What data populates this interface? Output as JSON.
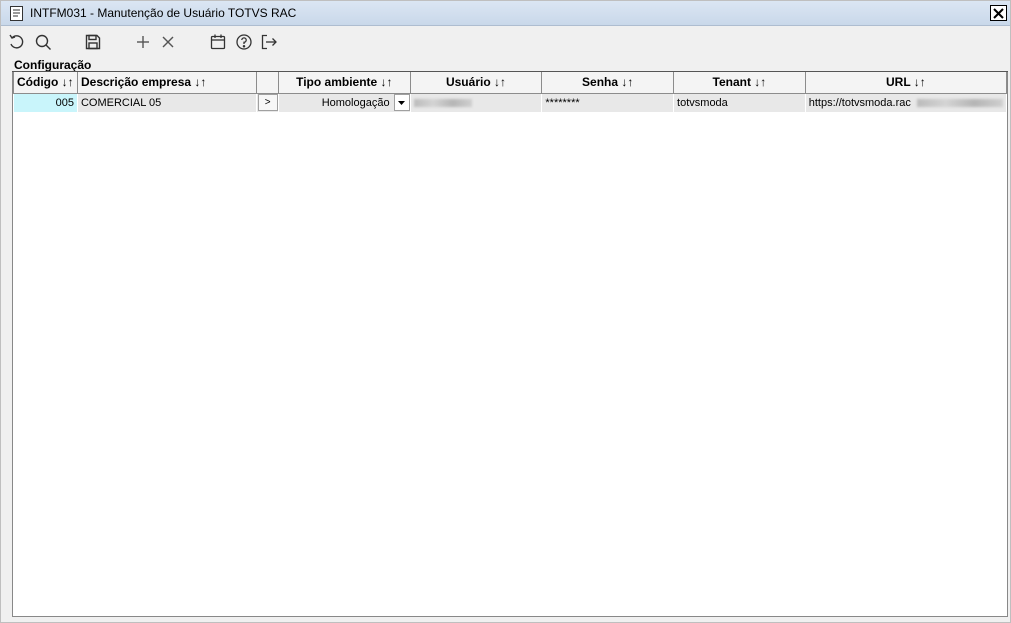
{
  "window": {
    "title": "INTFM031 - Manutenção de Usuário TOTVS RAC"
  },
  "toolbar": {
    "icons": [
      "refresh-icon",
      "search-icon",
      "save-icon",
      "add-icon",
      "delete-icon",
      "calendar-icon",
      "help-icon",
      "exit-icon"
    ]
  },
  "section": {
    "label": "Configuração"
  },
  "grid": {
    "columns": [
      {
        "label": "Código ↓↑"
      },
      {
        "label": "Descrição empresa ↓↑"
      },
      {
        "label": ""
      },
      {
        "label": "Tipo ambiente ↓↑"
      },
      {
        "label": "Usuário ↓↑"
      },
      {
        "label": "Senha ↓↑"
      },
      {
        "label": "Tenant ↓↑"
      },
      {
        "label": "URL ↓↑"
      }
    ],
    "rows": [
      {
        "codigo": "005",
        "descricao": "COMERCIAL 05",
        "detail_button": ">",
        "tipo_ambiente": "Homologação",
        "usuario": "",
        "senha": "********",
        "tenant": "totvsmoda",
        "url": "https://totvsmoda.rac"
      }
    ]
  },
  "colors": {
    "selected_cell": "#c9f5fb",
    "row_bg": "#e8e8e8",
    "titlebar": "#d3e0ef"
  }
}
